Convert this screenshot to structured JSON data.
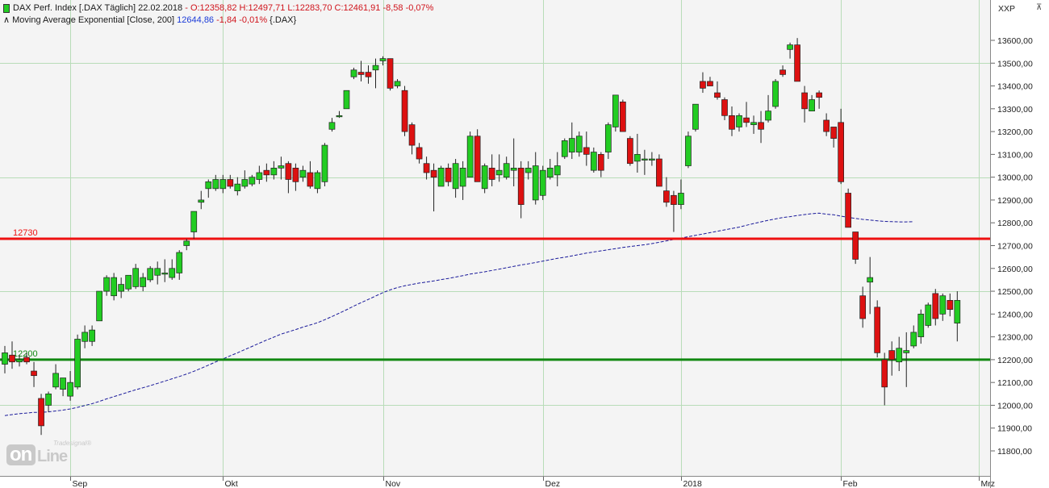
{
  "header": {
    "line1_name": "DAX Perf. Index [.DAX Täglich]",
    "line1_date": "22.02.2018",
    "line1_ohlc": "- O:12358,82 H:12497,71 L:12283,70 C:12461,91 -8,58 -0,07%",
    "line2_name": "Moving Average Exponential [Close, 200]",
    "line2_value": "12644,86",
    "line2_change": "-1,84 -0,01%",
    "line2_symbol": "{.DAX}"
  },
  "axis_header": "XXP",
  "corner_glyph": "⊼",
  "logo": {
    "big": "on",
    "rest": "Line",
    "small": "Tradesignal®"
  },
  "colors": {
    "up": "#22cc22",
    "down": "#dd1111",
    "ema": "#1a1a9a",
    "resistance": "#ee1111",
    "support": "#118811",
    "grid": "#b8dcb8"
  },
  "chart_data": {
    "type": "candlestick",
    "ylim": [
      11700,
      13720
    ],
    "y_ticks": [
      11800,
      11900,
      12000,
      12100,
      12200,
      12300,
      12400,
      12500,
      12600,
      12700,
      12800,
      12900,
      13000,
      13100,
      13200,
      13300,
      13400,
      13500,
      13600
    ],
    "y_tick_labels": [
      "11800,00",
      "11900,00",
      "12000,00",
      "12100,00",
      "12200,00",
      "12300,00",
      "12400,00",
      "12500,00",
      "12600,00",
      "12700,00",
      "12800,00",
      "12900,00",
      "13000,00",
      "13100,00",
      "13200,00",
      "13300,00",
      "13400,00",
      "13500,00",
      "13600,00"
    ],
    "grid_levels": [
      12000,
      12500,
      13000,
      13500
    ],
    "months": [
      {
        "label": "Sep",
        "index": 9
      },
      {
        "label": "Okt",
        "index": 30
      },
      {
        "label": "Nov",
        "index": 52
      },
      {
        "label": "Dez",
        "index": 74
      },
      {
        "label": "2018",
        "index": 93
      },
      {
        "label": "Feb",
        "index": 115
      },
      {
        "label": "Mrz",
        "index": 134
      }
    ],
    "horizontal_lines": [
      {
        "value": 12730,
        "label": "12730",
        "color": "#ee1111"
      },
      {
        "value": 12200,
        "label": "12200",
        "color": "#118811"
      }
    ],
    "candles": [
      [
        12140,
        12260,
        12180,
        12230
      ],
      [
        12160,
        12280,
        12220,
        12190
      ],
      [
        12170,
        12220,
        12190,
        12200
      ],
      [
        12180,
        12230,
        12210,
        12190
      ],
      [
        12080,
        12190,
        12150,
        12130
      ],
      [
        11870,
        12050,
        12030,
        11910
      ],
      [
        11970,
        12060,
        12000,
        12050
      ],
      [
        12070,
        12180,
        12080,
        12140
      ],
      [
        12040,
        12120,
        12070,
        12120
      ],
      [
        12020,
        12150,
        12040,
        12100
      ],
      [
        12070,
        12310,
        12080,
        12290
      ],
      [
        12250,
        12350,
        12280,
        12320
      ],
      [
        12260,
        12350,
        12280,
        12330
      ],
      [
        12370,
        12500,
        12370,
        12500
      ],
      [
        12480,
        12570,
        12500,
        12560
      ],
      [
        12460,
        12580,
        12480,
        12560
      ],
      [
        12470,
        12560,
        12500,
        12530
      ],
      [
        12500,
        12570,
        12510,
        12570
      ],
      [
        12510,
        12620,
        12520,
        12600
      ],
      [
        12500,
        12580,
        12520,
        12560
      ],
      [
        12540,
        12610,
        12550,
        12600
      ],
      [
        12530,
        12630,
        12570,
        12600
      ],
      [
        12540,
        12640,
        12580,
        12580
      ],
      [
        12550,
        12640,
        12560,
        12600
      ],
      [
        12550,
        12680,
        12580,
        12670
      ],
      [
        12680,
        12730,
        12700,
        12720
      ],
      [
        12730,
        12850,
        12760,
        12850
      ],
      [
        12860,
        12940,
        12890,
        12900
      ],
      [
        12910,
        12990,
        12950,
        12980
      ],
      [
        12940,
        13010,
        12950,
        12990
      ],
      [
        12930,
        13010,
        12950,
        12990
      ],
      [
        12950,
        13010,
        12990,
        12960
      ],
      [
        12920,
        13000,
        12940,
        12970
      ],
      [
        12950,
        13030,
        12960,
        12990
      ],
      [
        12960,
        13010,
        12970,
        13000
      ],
      [
        12970,
        13050,
        12990,
        13020
      ],
      [
        12980,
        13060,
        13030,
        13010
      ],
      [
        12990,
        13070,
        13010,
        13040
      ],
      [
        12990,
        13090,
        13040,
        13050
      ],
      [
        12930,
        13070,
        13060,
        12990
      ],
      [
        12940,
        13060,
        13040,
        12980
      ],
      [
        12980,
        13050,
        13000,
        13030
      ],
      [
        12950,
        13070,
        13020,
        12960
      ],
      [
        12930,
        13030,
        12950,
        13020
      ],
      [
        12960,
        13150,
        12980,
        13140
      ],
      [
        13200,
        13260,
        13210,
        13240
      ],
      [
        13260,
        13290,
        13270,
        13270
      ],
      [
        13300,
        13360,
        13300,
        13380
      ],
      [
        13430,
        13480,
        13440,
        13470
      ],
      [
        13420,
        13510,
        13460,
        13450
      ],
      [
        13410,
        13490,
        13460,
        13440
      ],
      [
        13390,
        13520,
        13470,
        13490
      ],
      [
        13490,
        13530,
        13510,
        13520
      ],
      [
        13380,
        13520,
        13520,
        13390
      ],
      [
        13390,
        13430,
        13400,
        13420
      ],
      [
        13180,
        13400,
        13380,
        13200
      ],
      [
        13100,
        13240,
        13230,
        13140
      ],
      [
        13060,
        13150,
        13130,
        13080
      ],
      [
        12990,
        13090,
        13060,
        13020
      ],
      [
        12850,
        13060,
        13030,
        13000
      ],
      [
        12960,
        13050,
        12960,
        13040
      ],
      [
        12960,
        13060,
        13040,
        12980
      ],
      [
        12910,
        13080,
        12950,
        13060
      ],
      [
        12900,
        13070,
        12960,
        13040
      ],
      [
        13000,
        13200,
        13000,
        13180
      ],
      [
        13000,
        13210,
        13180,
        12980
      ],
      [
        12930,
        13060,
        12950,
        13050
      ],
      [
        12960,
        13100,
        13040,
        12990
      ],
      [
        12980,
        13100,
        13010,
        13030
      ],
      [
        12990,
        13090,
        13000,
        13060
      ],
      [
        12960,
        13170,
        13030,
        13040
      ],
      [
        12820,
        13070,
        13040,
        12880
      ],
      [
        12990,
        13070,
        13020,
        13040
      ],
      [
        12880,
        13110,
        12900,
        13050
      ],
      [
        12900,
        13050,
        12920,
        13030
      ],
      [
        12990,
        13080,
        13000,
        13040
      ],
      [
        12960,
        13110,
        13010,
        13050
      ],
      [
        13080,
        13170,
        13090,
        13160
      ],
      [
        13080,
        13240,
        13110,
        13170
      ],
      [
        13090,
        13200,
        13110,
        13180
      ],
      [
        13050,
        13200,
        13130,
        13100
      ],
      [
        13020,
        13130,
        13030,
        13110
      ],
      [
        13000,
        13110,
        13100,
        13030
      ],
      [
        13080,
        13240,
        13110,
        13230
      ],
      [
        13200,
        13330,
        13220,
        13360
      ],
      [
        13260,
        13340,
        13330,
        13200
      ],
      [
        13050,
        13180,
        13170,
        13060
      ],
      [
        13020,
        13190,
        13070,
        13100
      ],
      [
        13010,
        13120,
        13080,
        13080
      ],
      [
        13050,
        13110,
        13080,
        13080
      ],
      [
        12990,
        13100,
        13080,
        12960
      ],
      [
        12870,
        13000,
        12940,
        12890
      ],
      [
        12760,
        12940,
        12920,
        12880
      ],
      [
        12860,
        12990,
        12880,
        12930
      ],
      [
        13040,
        13200,
        13050,
        13180
      ],
      [
        13200,
        13320,
        13210,
        13320
      ],
      [
        13370,
        13460,
        13420,
        13390
      ],
      [
        13400,
        13440,
        13420,
        13400
      ],
      [
        13340,
        13420,
        13370,
        13350
      ],
      [
        13250,
        13350,
        13340,
        13270
      ],
      [
        13180,
        13310,
        13270,
        13210
      ],
      [
        13200,
        13280,
        13220,
        13270
      ],
      [
        13220,
        13330,
        13260,
        13240
      ],
      [
        13190,
        13270,
        13230,
        13240
      ],
      [
        13150,
        13290,
        13240,
        13210
      ],
      [
        13240,
        13360,
        13250,
        13290
      ],
      [
        13300,
        13430,
        13310,
        13420
      ],
      [
        13440,
        13490,
        13470,
        13450
      ],
      [
        13520,
        13590,
        13560,
        13580
      ],
      [
        13420,
        13610,
        13580,
        13420
      ],
      [
        13240,
        13400,
        13370,
        13300
      ],
      [
        13290,
        13360,
        13290,
        13340
      ],
      [
        13300,
        13380,
        13370,
        13350
      ],
      [
        13180,
        13280,
        13250,
        13200
      ],
      [
        13130,
        13220,
        13220,
        13170
      ],
      [
        12970,
        13300,
        13240,
        12980
      ],
      [
        12780,
        12950,
        12930,
        12780
      ],
      [
        12620,
        12760,
        12760,
        12640
      ],
      [
        12340,
        12520,
        12480,
        12380
      ],
      [
        12400,
        12650,
        12540,
        12560
      ],
      [
        12210,
        12460,
        12430,
        12230
      ],
      [
        12000,
        12230,
        12200,
        12080
      ],
      [
        12130,
        12280,
        12240,
        12200
      ],
      [
        12150,
        12300,
        12190,
        12250
      ],
      [
        12080,
        12320,
        12230,
        12240
      ],
      [
        12250,
        12350,
        12260,
        12320
      ],
      [
        12270,
        12420,
        12300,
        12400
      ],
      [
        12340,
        12450,
        12350,
        12440
      ],
      [
        12350,
        12510,
        12490,
        12380
      ],
      [
        12370,
        12490,
        12400,
        12480
      ],
      [
        12390,
        12490,
        12460,
        12420
      ],
      [
        12280,
        12500,
        12360,
        12460
      ]
    ],
    "ema_200": [
      11955,
      11959,
      11963,
      11966,
      11969,
      11969,
      11971,
      11975,
      11979,
      11984,
      11991,
      11999,
      12007,
      12017,
      12028,
      12038,
      12048,
      12058,
      12068,
      12077,
      12086,
      12096,
      12106,
      12116,
      12126,
      12137,
      12149,
      12162,
      12176,
      12190,
      12203,
      12217,
      12230,
      12244,
      12258,
      12272,
      12286,
      12299,
      12312,
      12322,
      12332,
      12343,
      12352,
      12362,
      12375,
      12389,
      12404,
      12419,
      12435,
      12450,
      12464,
      12479,
      12494,
      12506,
      12516,
      12524,
      12530,
      12536,
      12540,
      12545,
      12551,
      12556,
      12562,
      12568,
      12575,
      12580,
      12585,
      12591,
      12597,
      12603,
      12609,
      12615,
      12620,
      12626,
      12632,
      12638,
      12644,
      12649,
      12655,
      12661,
      12667,
      12672,
      12677,
      12682,
      12687,
      12692,
      12696,
      12700,
      12704,
      12709,
      12715,
      12721,
      12727,
      12733,
      12739,
      12745,
      12751,
      12757,
      12763,
      12769,
      12775,
      12781,
      12789,
      12797,
      12804,
      12811,
      12817,
      12823,
      12827,
      12832,
      12836,
      12840,
      12842,
      12838,
      12835,
      12829,
      12824,
      12819,
      12815,
      12812,
      12809,
      12806,
      12805,
      12804,
      12804,
      12805
    ]
  }
}
